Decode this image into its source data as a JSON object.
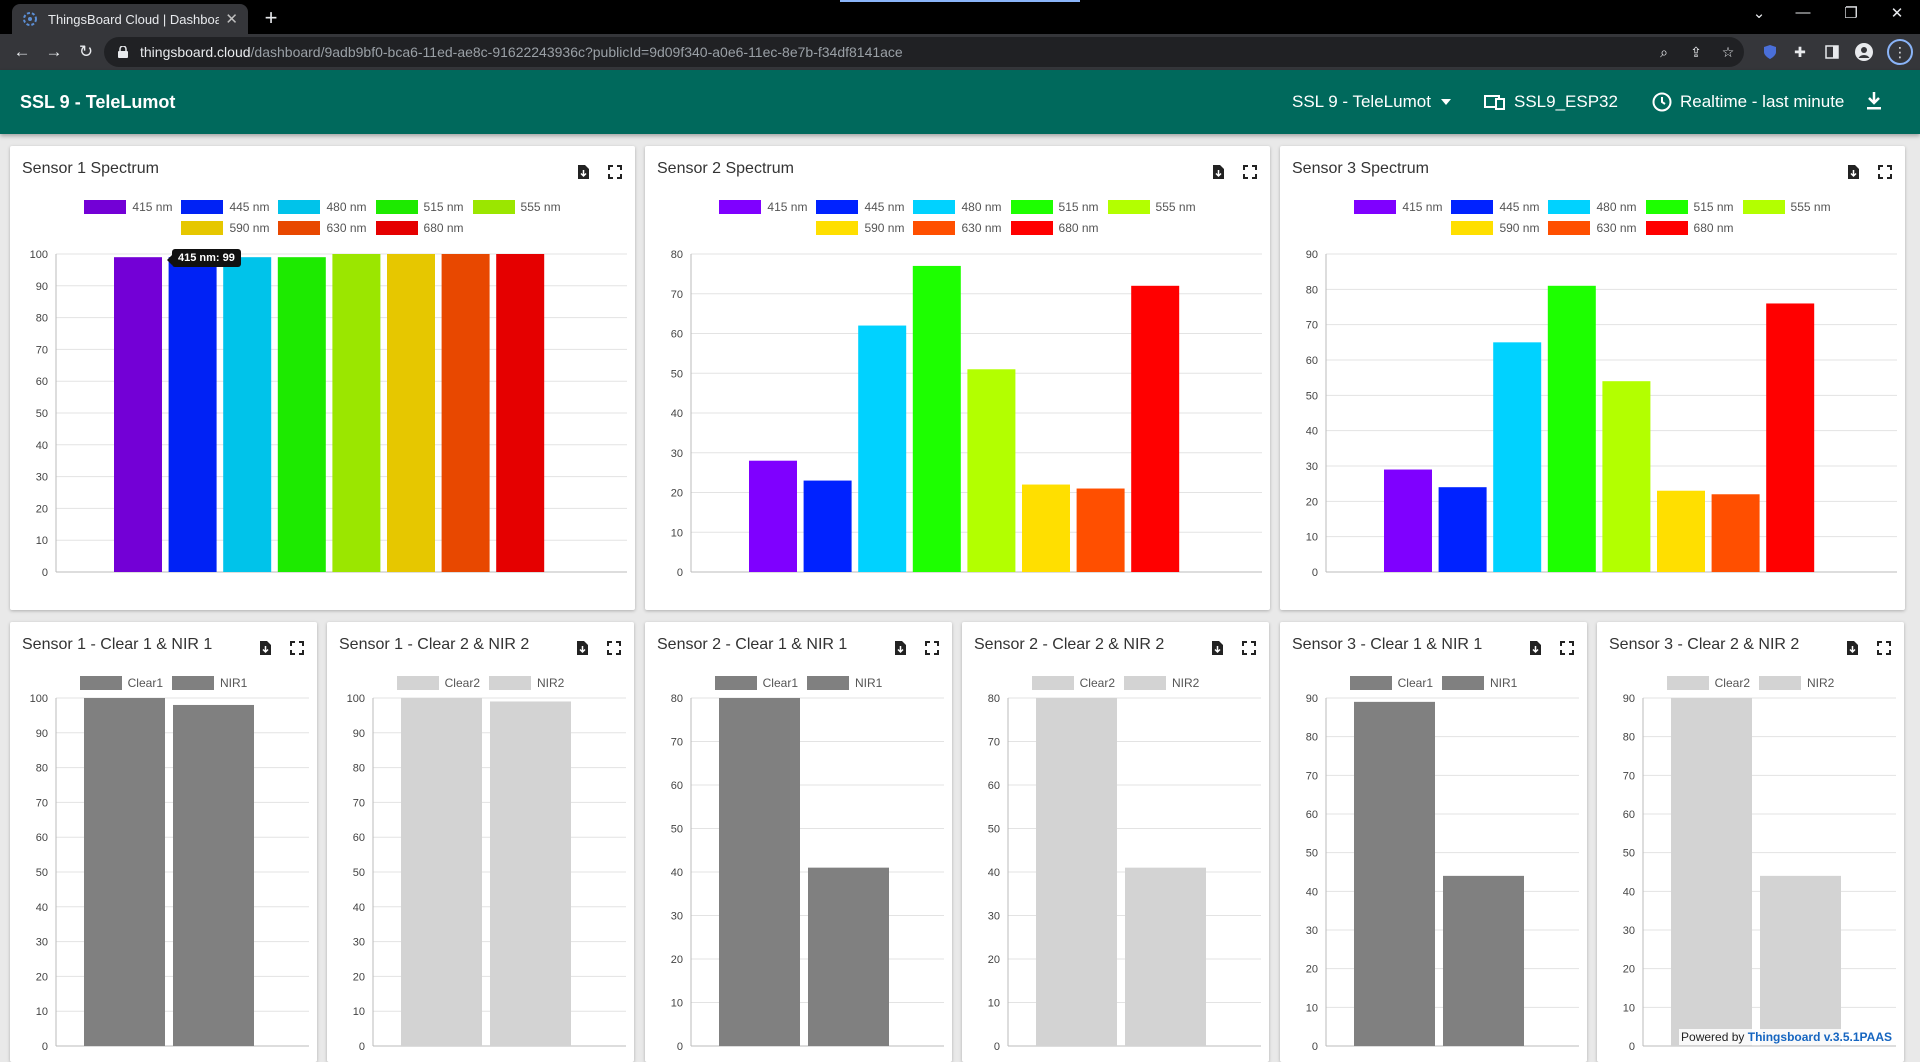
{
  "browser": {
    "tab_title": "ThingsBoard Cloud | Dashboard",
    "url_host": "thingsboard.cloud",
    "url_path": "/dashboard/9adb9bf0-bca6-11ed-ae8c-91622243936c?publicId=9d09f340-a0e6-11ec-8e7b-f34df8141ace"
  },
  "header": {
    "title": "SSL 9 - TeleLumot",
    "state_select": "SSL 9 - TeleLumot",
    "entity": "SSL9_ESP32",
    "timewindow": "Realtime - last minute"
  },
  "footer": {
    "powered_by": "Powered by",
    "version": "Thingsboard v.3.5.1PAAS"
  },
  "colors": {
    "header_bg": "#00695c",
    "clear1": "#808080",
    "nir1": "#808080",
    "clear2": "#d3d3d3",
    "nir2": "#d3d3d3"
  },
  "spectrum_widgets": [
    {
      "title": "Sensor 1 Spectrum",
      "tooltip": "415 nm: 99",
      "chart_data": {
        "type": "bar",
        "categories": [
          "415 nm",
          "445 nm",
          "480 nm",
          "515 nm",
          "555 nm",
          "590 nm",
          "630 nm",
          "680 nm"
        ],
        "values": [
          99,
          99,
          99,
          99,
          100,
          100,
          100,
          100
        ],
        "colors": [
          "#7300d6",
          "#0022f5",
          "#00c3ea",
          "#1dea00",
          "#9be600",
          "#e6c700",
          "#e84800",
          "#e50000"
        ],
        "ylim": [
          0,
          100
        ],
        "yticks": [
          0,
          10,
          20,
          30,
          40,
          50,
          60,
          70,
          80,
          90,
          100
        ]
      }
    },
    {
      "title": "Sensor 2 Spectrum",
      "chart_data": {
        "type": "bar",
        "categories": [
          "415 nm",
          "445 nm",
          "480 nm",
          "515 nm",
          "555 nm",
          "590 nm",
          "630 nm",
          "680 nm"
        ],
        "values": [
          28,
          23,
          62,
          77,
          51,
          22,
          21,
          72
        ],
        "colors": [
          "#7f00ff",
          "#0022ff",
          "#00d2ff",
          "#1dff00",
          "#b3ff00",
          "#ffdf00",
          "#ff4f00",
          "#ff0000"
        ],
        "ylim": [
          0,
          80
        ],
        "yticks": [
          0,
          10,
          20,
          30,
          40,
          50,
          60,
          70,
          80
        ]
      }
    },
    {
      "title": "Sensor 3 Spectrum",
      "chart_data": {
        "type": "bar",
        "categories": [
          "415 nm",
          "445 nm",
          "480 nm",
          "515 nm",
          "555 nm",
          "590 nm",
          "630 nm",
          "680 nm"
        ],
        "values": [
          29,
          24,
          65,
          81,
          54,
          23,
          22,
          76
        ],
        "colors": [
          "#7f00ff",
          "#0022ff",
          "#00d2ff",
          "#1dff00",
          "#b3ff00",
          "#ffdf00",
          "#ff4f00",
          "#ff0000"
        ],
        "ylim": [
          0,
          90
        ],
        "yticks": [
          0,
          10,
          20,
          30,
          40,
          50,
          60,
          70,
          80,
          90
        ]
      }
    }
  ],
  "clearnir_widgets": [
    {
      "title": "Sensor 1 - Clear 1 & NIR 1",
      "chart_data": {
        "type": "bar",
        "categories": [
          "Clear1",
          "NIR1"
        ],
        "values": [
          100,
          98
        ],
        "colors": [
          "#808080",
          "#808080"
        ],
        "ylim": [
          0,
          100
        ],
        "yticks": [
          0,
          10,
          20,
          30,
          40,
          50,
          60,
          70,
          80,
          90,
          100
        ]
      }
    },
    {
      "title": "Sensor 1 - Clear 2 & NIR 2",
      "chart_data": {
        "type": "bar",
        "categories": [
          "Clear2",
          "NIR2"
        ],
        "values": [
          100,
          99
        ],
        "colors": [
          "#d3d3d3",
          "#d3d3d3"
        ],
        "ylim": [
          0,
          100
        ],
        "yticks": [
          0,
          10,
          20,
          30,
          40,
          50,
          60,
          70,
          80,
          90,
          100
        ]
      }
    },
    {
      "title": "Sensor 2 - Clear 1 & NIR 1",
      "chart_data": {
        "type": "bar",
        "categories": [
          "Clear1",
          "NIR1"
        ],
        "values": [
          80,
          41
        ],
        "colors": [
          "#808080",
          "#808080"
        ],
        "ylim": [
          0,
          80
        ],
        "yticks": [
          0,
          10,
          20,
          30,
          40,
          50,
          60,
          70,
          80
        ]
      }
    },
    {
      "title": "Sensor 2 - Clear 2 & NIR 2",
      "chart_data": {
        "type": "bar",
        "categories": [
          "Clear2",
          "NIR2"
        ],
        "values": [
          80,
          41
        ],
        "colors": [
          "#d3d3d3",
          "#d3d3d3"
        ],
        "ylim": [
          0,
          80
        ],
        "yticks": [
          0,
          10,
          20,
          30,
          40,
          50,
          60,
          70,
          80
        ]
      }
    },
    {
      "title": "Sensor 3 - Clear 1 & NIR 1",
      "chart_data": {
        "type": "bar",
        "categories": [
          "Clear1",
          "NIR1"
        ],
        "values": [
          89,
          44
        ],
        "colors": [
          "#808080",
          "#808080"
        ],
        "ylim": [
          0,
          90
        ],
        "yticks": [
          0,
          10,
          20,
          30,
          40,
          50,
          60,
          70,
          80,
          90
        ]
      }
    },
    {
      "title": "Sensor 3 - Clear 2 & NIR 2",
      "chart_data": {
        "type": "bar",
        "categories": [
          "Clear2",
          "NIR2"
        ],
        "values": [
          90,
          44
        ],
        "colors": [
          "#d3d3d3",
          "#d3d3d3"
        ],
        "ylim": [
          0,
          90
        ],
        "yticks": [
          0,
          10,
          20,
          30,
          40,
          50,
          60,
          70,
          80,
          90
        ]
      }
    }
  ]
}
